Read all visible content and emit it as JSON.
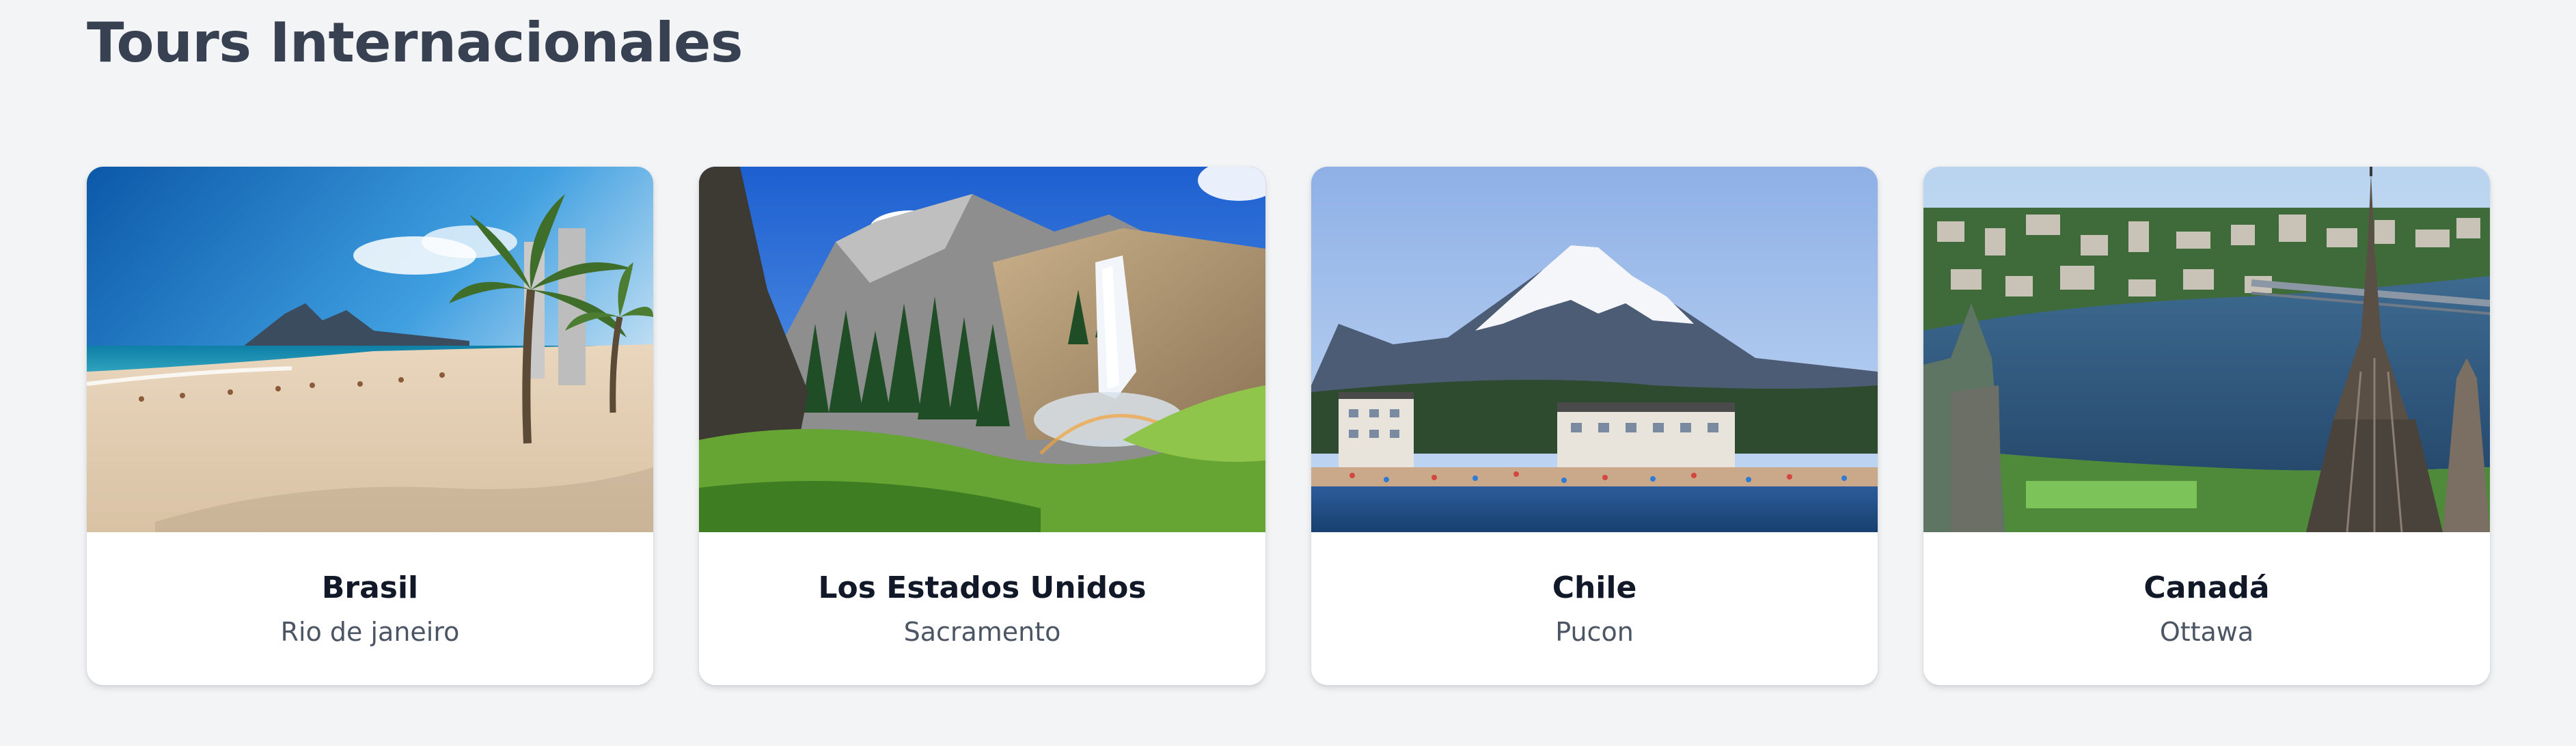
{
  "section": {
    "title": "Tours Internacionales"
  },
  "tours": [
    {
      "country": "Brasil",
      "city": "Rio de janeiro",
      "image": "beach-palm-trees-photo"
    },
    {
      "country": "Los Estados Unidos",
      "city": "Sacramento",
      "image": "waterfall-canyon-photo"
    },
    {
      "country": "Chile",
      "city": "Pucon",
      "image": "snow-volcano-lake-photo"
    },
    {
      "country": "Canadá",
      "city": "Ottawa",
      "image": "city-river-parliament-photo"
    }
  ]
}
